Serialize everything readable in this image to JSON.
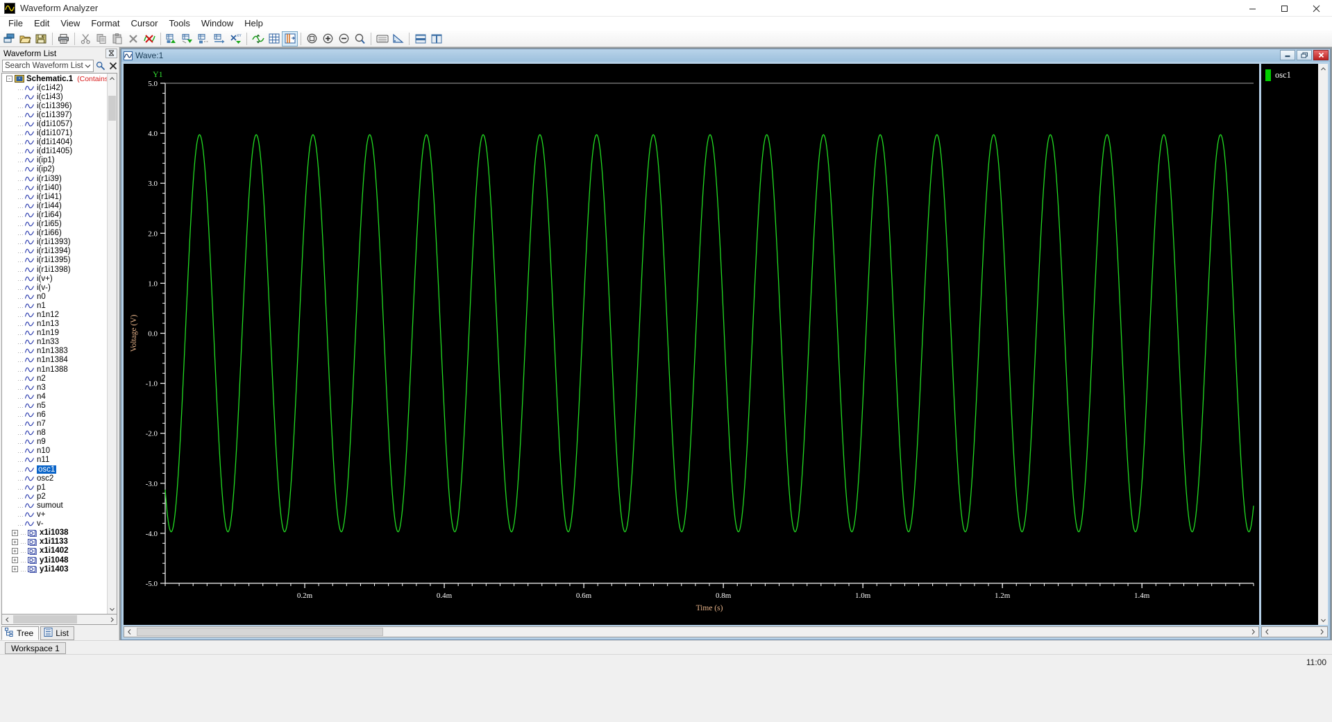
{
  "window": {
    "title": "Waveform Analyzer",
    "app_icon": "waveform-icon",
    "controls": {
      "minimize": "minimize-icon",
      "maximize": "maximize-icon",
      "close": "close-icon"
    }
  },
  "menubar": {
    "items": [
      "File",
      "Edit",
      "View",
      "Format",
      "Cursor",
      "Tools",
      "Window",
      "Help"
    ]
  },
  "toolbar": {
    "groups": [
      [
        "new-window-icon",
        "open-folder-icon",
        "save-icon"
      ],
      [
        "print-icon"
      ],
      [
        "cut-icon",
        "copy-icon",
        "paste-icon",
        "delete-icon",
        "delete-waveform-icon"
      ],
      [
        "add-wave-icon",
        "overlay-wave-icon",
        "stack-wave-icon",
        "append-wave-icon",
        "xy-plot-icon"
      ],
      [
        "axis-settings-icon",
        "grid-icon",
        "marker-icon"
      ],
      [
        "zoom-fit-icon",
        "zoom-in-icon",
        "zoom-out-icon",
        "zoom-area-icon"
      ],
      [
        "measurement-icon",
        "calculator-icon"
      ],
      [
        "tile-horizontal-icon",
        "tile-vertical-icon"
      ]
    ]
  },
  "sidebar": {
    "title": "Waveform List",
    "close_icon": "close-panel-icon",
    "search": {
      "placeholder": "Search Waveform List",
      "value": "",
      "dropdown_icon": "chevron-down-icon",
      "search_icon": "search-icon",
      "clear_icon": "clear-icon"
    },
    "root": {
      "label": "Schematic.1",
      "note": "(Contains un",
      "expander": "-",
      "icon": "schematic-icon"
    },
    "items": [
      "i(c1i42)",
      "i(c1i43)",
      "i(c1i1396)",
      "i(c1i1397)",
      "i(d1i1057)",
      "i(d1i1071)",
      "i(d1i1404)",
      "i(d1i1405)",
      "i(ip1)",
      "i(ip2)",
      "i(r1i39)",
      "i(r1i40)",
      "i(r1i41)",
      "i(r1i44)",
      "i(r1i64)",
      "i(r1i65)",
      "i(r1i66)",
      "i(r1i1393)",
      "i(r1i1394)",
      "i(r1i1395)",
      "i(r1i1398)",
      "i(v+)",
      "i(v-)",
      "n0",
      "n1",
      "n1n12",
      "n1n13",
      "n1n19",
      "n1n33",
      "n1n1383",
      "n1n1384",
      "n1n1388",
      "n2",
      "n3",
      "n4",
      "n5",
      "n6",
      "n7",
      "n8",
      "n9",
      "n10",
      "n11",
      "osc1",
      "osc2",
      "p1",
      "p2",
      "sumout",
      "v+",
      "v-"
    ],
    "selected_item": "osc1",
    "subcircuits": [
      "x1i1038",
      "x1i1133",
      "x1i1402",
      "y1i1048",
      "y1i1403"
    ],
    "tabs": [
      {
        "label": "Tree",
        "icon": "tree-icon",
        "active": true
      },
      {
        "label": "List",
        "icon": "list-icon",
        "active": false
      }
    ],
    "scrollbar": {
      "up_icon": "scroll-up-icon",
      "down_icon": "scroll-down-icon",
      "left_icon": "scroll-left-icon",
      "right_icon": "scroll-right-icon"
    }
  },
  "wave_window": {
    "title": "Wave:1",
    "icon": "wave-icon",
    "controls": {
      "minimize": "minimize-icon",
      "restore": "restore-icon",
      "close": "close-icon"
    }
  },
  "legend": {
    "entries": [
      {
        "label": "osc1",
        "color": "#00d000"
      }
    ]
  },
  "workspace": {
    "tabs": [
      "Workspace 1"
    ]
  },
  "statusbar": {
    "clock": "11:00"
  },
  "colors": {
    "trace": "#22dd22",
    "plot_background": "#000000",
    "axis_text": "#ffffff",
    "axis_title": "#e8b48a",
    "y1_label": "#33dd33",
    "selection": "#0a64c8",
    "tree_wave_icon": "#2233aa"
  },
  "chart_data": {
    "type": "line",
    "title": "Wave:1",
    "xlabel": "Time (s)",
    "ylabel": "Voltage (V)",
    "y_axis_name": "Y1",
    "xlim": [
      0.0,
      0.00156
    ],
    "ylim": [
      -5.0,
      5.0
    ],
    "x_tick_labels": [
      "0.2m",
      "0.4m",
      "0.6m",
      "0.8m",
      "1.0m",
      "1.2m",
      "1.4m"
    ],
    "x_tick_values": [
      0.0002,
      0.0004,
      0.0006,
      0.0008,
      0.001,
      0.0012,
      0.0014
    ],
    "x_minor_ticks_per_major": 10,
    "y_tick_labels": [
      "5.0",
      "4.0",
      "3.0",
      "2.0",
      "1.0",
      "0.0",
      "-1.0",
      "-2.0",
      "-3.0",
      "-4.0",
      "-5.0"
    ],
    "y_tick_values": [
      5.0,
      4.0,
      3.0,
      2.0,
      1.0,
      0.0,
      -1.0,
      -2.0,
      -3.0,
      -4.0,
      -5.0
    ],
    "y_minor_ticks_per_major": 5,
    "grid": false,
    "legend_position": "right",
    "series": [
      {
        "name": "osc1",
        "color": "#22dd22",
        "waveform": "sine",
        "amplitude": 3.97,
        "offset": 0.0,
        "frequency_hz": 12300,
        "period_s": 8.13e-05,
        "phase_deg": 232,
        "n_cycles_visible": 19,
        "y_min": -4.0,
        "y_max": 3.97,
        "description": "Oscillator output sine wave, ~4 V peak amplitude, ~12.3 kHz, spanning 0 to 1.56 ms"
      }
    ]
  }
}
